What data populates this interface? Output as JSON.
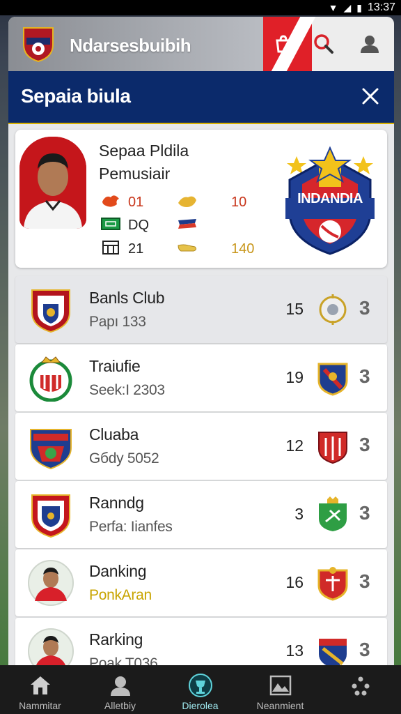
{
  "status_bar": {
    "time": "13:37"
  },
  "app_bar": {
    "title": "Ndarsesbuibih"
  },
  "banner": {
    "title": "Sepaia biula"
  },
  "profile": {
    "name": "Sepaa Pldila Pemusiair",
    "stats": [
      {
        "left": "01",
        "right": "10"
      },
      {
        "left": "DQ",
        "right": ""
      },
      {
        "left": "21",
        "right": "140"
      }
    ],
    "crest_text": "INDANDIA"
  },
  "rows": [
    {
      "name": "Banls Club",
      "sub": "Papı 133",
      "value": "15",
      "rank": "3",
      "selected": true
    },
    {
      "name": "Traiufie",
      "sub": "Seek:I 2303",
      "value": "19",
      "rank": "3"
    },
    {
      "name": "Cluaba",
      "sub": "Gбdy 5052",
      "value": "12",
      "rank": "3"
    },
    {
      "name": "Ranndg",
      "sub": "Perfa: Iianfes",
      "value": "3",
      "rank": "3"
    },
    {
      "name": "Danking",
      "sub": "PonkAran",
      "value": "16",
      "rank": "3"
    },
    {
      "name": "Rarking",
      "sub": "Poak T036",
      "value": "13",
      "rank": "3"
    }
  ],
  "bottom_nav": [
    {
      "label": "Nammitar",
      "icon": "home-icon"
    },
    {
      "label": "Alletbiy",
      "icon": "profile-icon"
    },
    {
      "label": "Dierolea",
      "icon": "trophy-icon",
      "active": true
    },
    {
      "label": "Neanmient",
      "icon": "image-icon"
    },
    {
      "label": "",
      "icon": "more-icon"
    }
  ]
}
